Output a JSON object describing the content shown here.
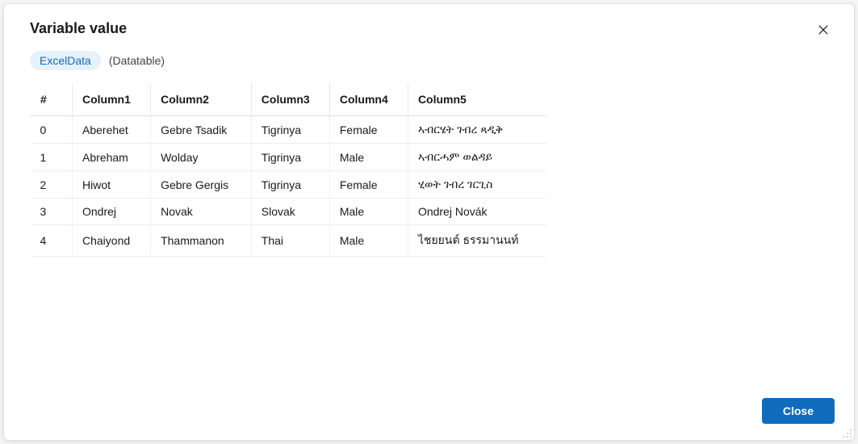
{
  "dialog": {
    "title": "Variable value",
    "close_button_label": "Close"
  },
  "variable": {
    "name": "ExcelData",
    "type_label": "(Datatable)"
  },
  "table": {
    "index_header": "#",
    "columns": [
      "Column1",
      "Column2",
      "Column3",
      "Column4",
      "Column5"
    ],
    "rows": [
      {
        "index": "0",
        "cells": [
          "Aberehet",
          "Gebre Tsadik",
          "Tigrinya",
          "Female",
          "ኣብርሄት ገብረ ጻዲቅ"
        ]
      },
      {
        "index": "1",
        "cells": [
          "Abreham",
          "Wolday",
          "Tigrinya",
          "Male",
          "ኣብርሓም ወልዳይ"
        ]
      },
      {
        "index": "2",
        "cells": [
          "Hiwot",
          "Gebre Gergis",
          "Tigrinya",
          "Female",
          "ሂወት ገብረ ገርጊስ"
        ]
      },
      {
        "index": "3",
        "cells": [
          "Ondrej",
          "Novak",
          "Slovak",
          "Male",
          "Ondrej Novák"
        ]
      },
      {
        "index": "4",
        "cells": [
          "Chaiyond",
          "Thammanon",
          "Thai",
          "Male",
          "ไชยยนต์ ธรรมานนท์"
        ]
      }
    ]
  }
}
